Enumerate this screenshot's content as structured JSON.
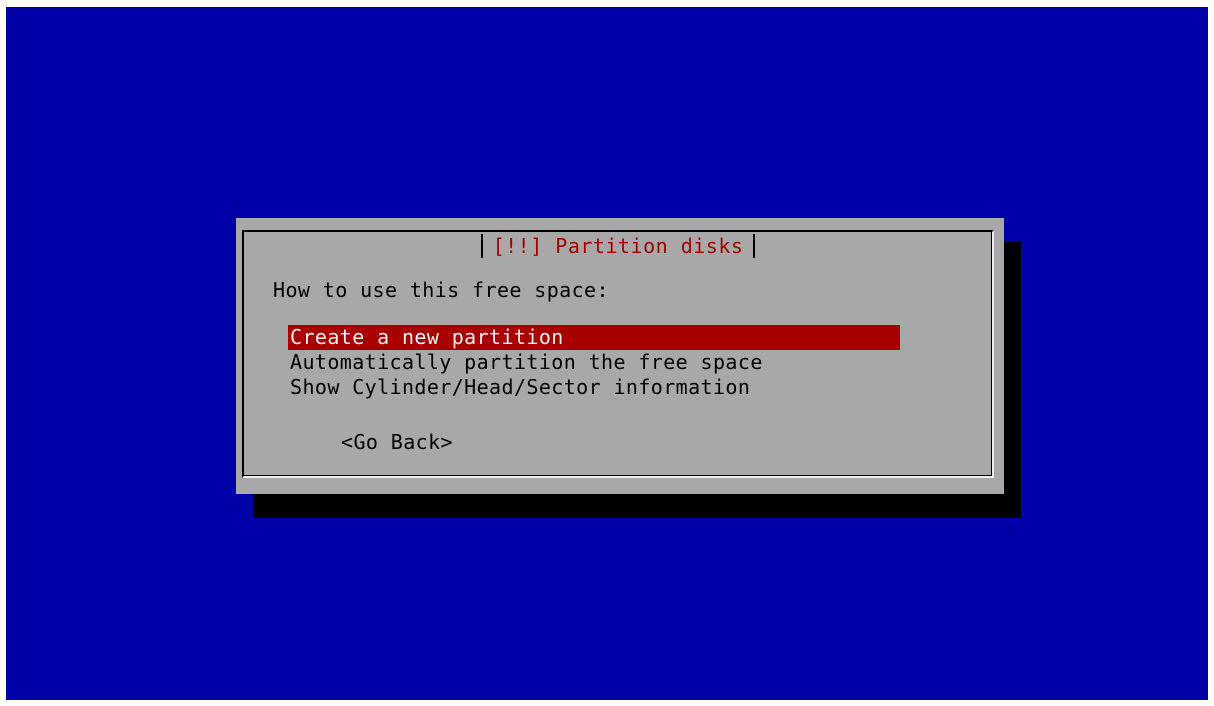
{
  "dialog": {
    "title": "[!!] Partition disks",
    "question": "How to use this free space:",
    "menu_items": [
      {
        "label": "Create a new partition",
        "selected": true
      },
      {
        "label": "Automatically partition the free space",
        "selected": false
      },
      {
        "label": "Show Cylinder/Head/Sector information",
        "selected": false
      }
    ],
    "back_button": "<Go Back>"
  },
  "colors": {
    "background": "#0000a8",
    "dialog": "#a8a8a8",
    "title_text": "#a80000",
    "selection": "#a80000",
    "shadow": "#000000"
  }
}
